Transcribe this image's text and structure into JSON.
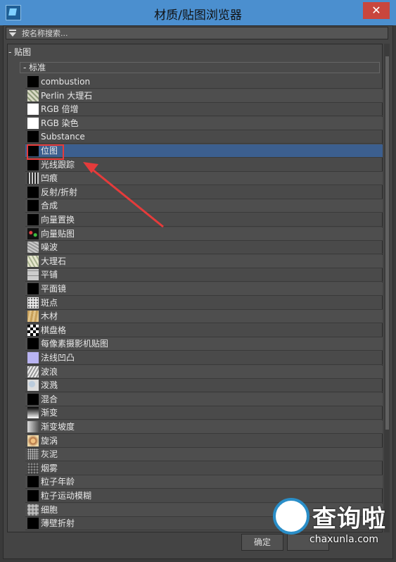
{
  "window": {
    "title": "材质/贴图浏览器",
    "close_label": "✕"
  },
  "search": {
    "placeholder": "按名称搜索..."
  },
  "tree": {
    "group_label": "- 贴图",
    "subgroup_label": "- 标准"
  },
  "maps": [
    {
      "label": "combustion",
      "swatch": "black"
    },
    {
      "label": "Perlin 大理石",
      "swatch": "marble-pattern"
    },
    {
      "label": "RGB 倍增",
      "swatch": "white"
    },
    {
      "label": "RGB 染色",
      "swatch": "white"
    },
    {
      "label": "Substance",
      "swatch": "black"
    },
    {
      "label": "位图",
      "swatch": "black",
      "selected": true
    },
    {
      "label": "光线跟踪",
      "swatch": "black"
    },
    {
      "label": "凹痕",
      "swatch": "dent-pattern"
    },
    {
      "label": "反射/折射",
      "swatch": "black"
    },
    {
      "label": "合成",
      "swatch": "black"
    },
    {
      "label": "向量置换",
      "swatch": "black"
    },
    {
      "label": "向量贴图",
      "swatch": "vector-pattern"
    },
    {
      "label": "噪波",
      "swatch": "noise-pattern"
    },
    {
      "label": "大理石",
      "swatch": "marble2-pattern"
    },
    {
      "label": "平铺",
      "swatch": "tile-pattern"
    },
    {
      "label": "平面镜",
      "swatch": "black"
    },
    {
      "label": "斑点",
      "swatch": "speckle-pattern"
    },
    {
      "label": "木材",
      "swatch": "wood-pattern"
    },
    {
      "label": "棋盘格",
      "swatch": "checker-pattern"
    },
    {
      "label": "每像素摄影机贴图",
      "swatch": "black"
    },
    {
      "label": "法线凹凸",
      "swatch": "lavender"
    },
    {
      "label": "波浪",
      "swatch": "wave-pattern"
    },
    {
      "label": "泼溅",
      "swatch": "splat-pattern"
    },
    {
      "label": "混合",
      "swatch": "black"
    },
    {
      "label": "渐变",
      "swatch": "gradient-pattern"
    },
    {
      "label": "渐变坡度",
      "swatch": "ramp-pattern"
    },
    {
      "label": "旋涡",
      "swatch": "swirl-pattern"
    },
    {
      "label": "灰泥",
      "swatch": "stucco-pattern"
    },
    {
      "label": "烟雾",
      "swatch": "smoke-pattern"
    },
    {
      "label": "粒子年龄",
      "swatch": "black"
    },
    {
      "label": "粒子运动模糊",
      "swatch": "black"
    },
    {
      "label": "细胞",
      "swatch": "cellular-pattern"
    },
    {
      "label": "薄壁折射",
      "swatch": "black"
    }
  ],
  "buttons": {
    "ok_label": "确定"
  },
  "watermark": {
    "title": "查询啦",
    "url": "chaxunla.com"
  },
  "colors": {
    "titlebar": "#4b8fcf",
    "selection": "#3c5f8f",
    "annotation": "#e53b3b"
  }
}
